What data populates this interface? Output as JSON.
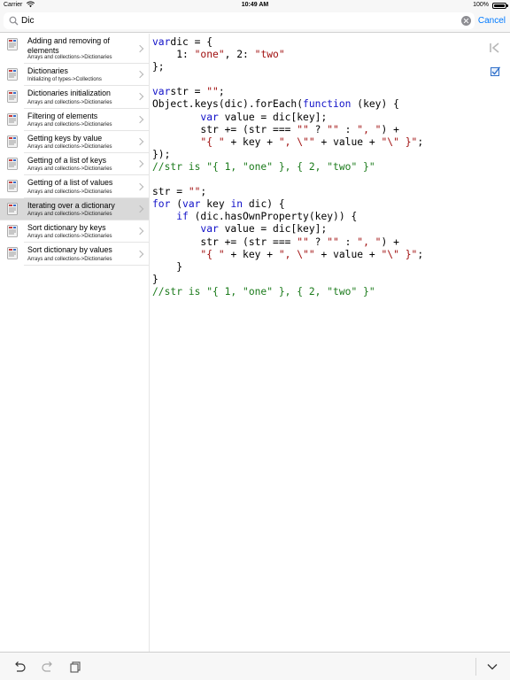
{
  "status_bar": {
    "carrier": "Carrier",
    "time": "10:49 AM",
    "battery": "100%",
    "battery_level": 1.0
  },
  "search": {
    "value": "Dic",
    "placeholder": "",
    "cancel_label": "Cancel"
  },
  "list": {
    "items": [
      {
        "title": "Adding and removing of elements",
        "subtitle": "Arrays and collections->Dictionaries",
        "selected": false
      },
      {
        "title": "Dictionaries",
        "subtitle": "Initializing of types->Collections",
        "selected": false
      },
      {
        "title": "Dictionaries initialization",
        "subtitle": "Arrays and collections->Dictionaries",
        "selected": false
      },
      {
        "title": "Filtering of elements",
        "subtitle": "Arrays and collections->Dictionaries",
        "selected": false
      },
      {
        "title": "Getting keys by value",
        "subtitle": "Arrays and collections->Dictionaries",
        "selected": false
      },
      {
        "title": "Getting of a list of keys",
        "subtitle": "Arrays and collections->Dictionaries",
        "selected": false
      },
      {
        "title": "Getting of a list of values",
        "subtitle": "Arrays and collections->Dictionaries",
        "selected": false
      },
      {
        "title": "Iterating over a dictionary",
        "subtitle": "Arrays and collections->Dictionaries",
        "selected": true
      },
      {
        "title": "Sort dictionary by keys",
        "subtitle": "Arrays and collections->Dictionaries",
        "selected": false
      },
      {
        "title": "Sort dictionary by values",
        "subtitle": "Arrays and collections->Dictionaries",
        "selected": false
      }
    ]
  },
  "code": {
    "lines": [
      [
        [
          "kw",
          "var"
        ],
        [
          "",
          "dic = {"
        ]
      ],
      [
        [
          "",
          "    1: "
        ],
        [
          "str",
          "\"one\""
        ],
        [
          "",
          ", 2: "
        ],
        [
          "str",
          "\"two\""
        ]
      ],
      [
        [
          "",
          "};"
        ]
      ],
      [
        [
          "",
          ""
        ]
      ],
      [
        [
          "kw",
          "var"
        ],
        [
          "",
          "str = "
        ],
        [
          "str",
          "\"\""
        ],
        [
          "",
          ";"
        ]
      ],
      [
        [
          "",
          "Object.keys(dic).forEach("
        ],
        [
          "kw",
          "function"
        ],
        [
          "",
          " (key) {"
        ]
      ],
      [
        [
          "",
          "        "
        ],
        [
          "kw",
          "var"
        ],
        [
          "",
          " value = dic[key];"
        ]
      ],
      [
        [
          "",
          "        str += (str === "
        ],
        [
          "str",
          "\"\""
        ],
        [
          "",
          " ? "
        ],
        [
          "str",
          "\"\""
        ],
        [
          "",
          " : "
        ],
        [
          "str",
          "\", \""
        ],
        [
          "",
          ") +"
        ]
      ],
      [
        [
          "",
          "        "
        ],
        [
          "str",
          "\"{ \""
        ],
        [
          "",
          " + key + "
        ],
        [
          "str",
          "\", \\\"\""
        ],
        [
          "",
          " + value + "
        ],
        [
          "str",
          "\"\\\" }\""
        ],
        [
          "",
          ";"
        ]
      ],
      [
        [
          "",
          "});"
        ]
      ],
      [
        [
          "cm",
          "//str is \"{ 1, \"one\" }, { 2, \"two\" }\""
        ]
      ],
      [
        [
          "",
          ""
        ]
      ],
      [
        [
          "",
          "str = "
        ],
        [
          "str",
          "\"\""
        ],
        [
          "",
          ";"
        ]
      ],
      [
        [
          "kw",
          "for"
        ],
        [
          "",
          " ("
        ],
        [
          "kw",
          "var"
        ],
        [
          "",
          " key "
        ],
        [
          "kw",
          "in"
        ],
        [
          "",
          " dic) {"
        ]
      ],
      [
        [
          "",
          "    "
        ],
        [
          "kw",
          "if"
        ],
        [
          "",
          " (dic.hasOwnProperty(key)) {"
        ]
      ],
      [
        [
          "",
          "        "
        ],
        [
          "kw",
          "var"
        ],
        [
          "",
          " value = dic[key];"
        ]
      ],
      [
        [
          "",
          "        str += (str === "
        ],
        [
          "str",
          "\"\""
        ],
        [
          "",
          " ? "
        ],
        [
          "str",
          "\"\""
        ],
        [
          "",
          " : "
        ],
        [
          "str",
          "\", \""
        ],
        [
          "",
          ") +"
        ]
      ],
      [
        [
          "",
          "        "
        ],
        [
          "str",
          "\"{ \""
        ],
        [
          "",
          " + key + "
        ],
        [
          "str",
          "\", \\\"\""
        ],
        [
          "",
          " + value + "
        ],
        [
          "str",
          "\"\\\" }\""
        ],
        [
          "",
          ";"
        ]
      ],
      [
        [
          "",
          "    }"
        ]
      ],
      [
        [
          "",
          "}"
        ]
      ],
      [
        [
          "cm",
          "//str is \"{ 1, \"one\" }, { 2, \"two\" }\""
        ]
      ]
    ]
  },
  "colors": {
    "accent": "#007aff",
    "keyword": "#1010c8",
    "string": "#a01010",
    "comment": "#1a7a1a",
    "selected_row": "#d9d9d9"
  },
  "icons": {
    "list_item": "document-icon",
    "search": "magnifier-icon",
    "clear": "clear-icon",
    "first": "go-first-icon",
    "check": "checkbox-icon",
    "undo": "undo-icon",
    "redo": "redo-icon",
    "copy": "copy-icon",
    "collapse": "chevron-down-icon"
  }
}
